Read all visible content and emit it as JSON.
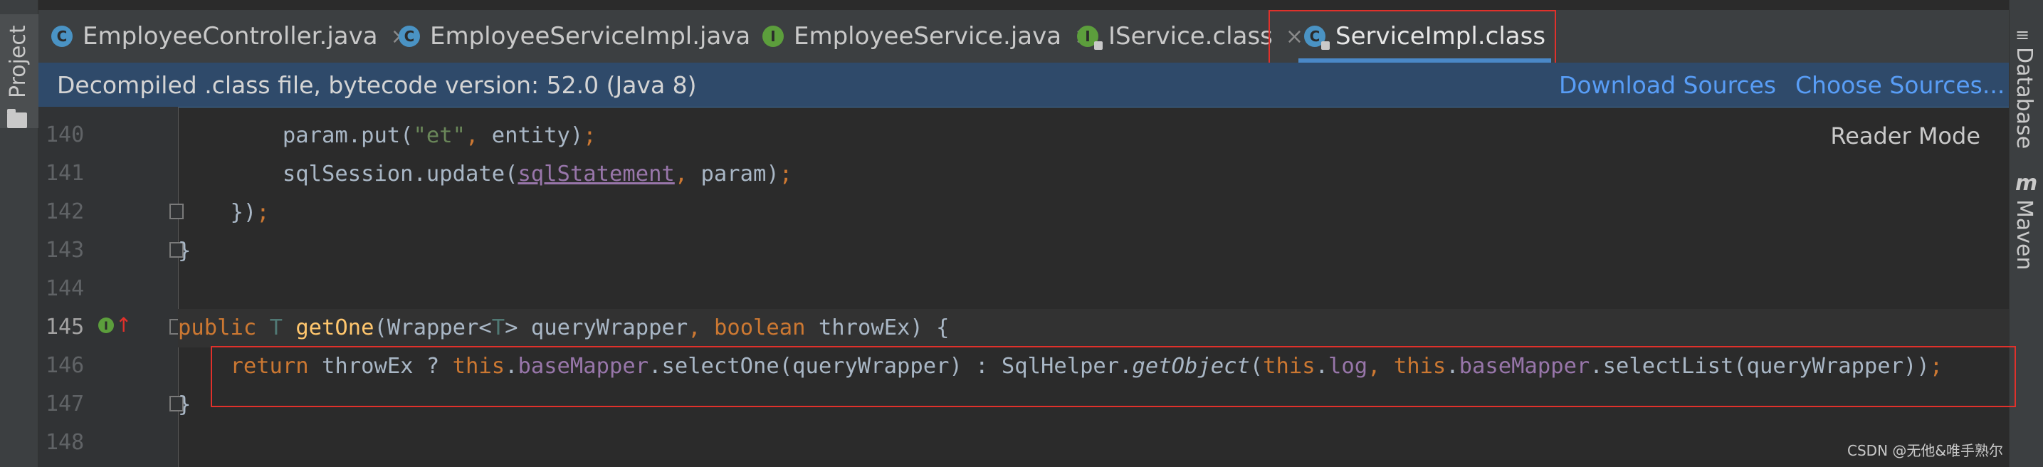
{
  "tool_windows": {
    "left": {
      "project_label": "Project",
      "folder_icon": "folder-icon"
    },
    "right": {
      "database_label": "Database",
      "maven_label": "Maven",
      "maven_icon_glyph": "m"
    }
  },
  "tabs": [
    {
      "label": "EmployeeController.java",
      "icon": "C",
      "icon_color": "#4a93c4",
      "close": "×"
    },
    {
      "label": "EmployeeServiceImpl.java",
      "icon": "C",
      "icon_color": "#4a93c4",
      "close": "×"
    },
    {
      "label": "EmployeeService.java",
      "icon": "I",
      "icon_color": "#5c9e3c",
      "close": "×"
    },
    {
      "label": "IService.class",
      "icon": "I",
      "icon_color": "#5c9e3c",
      "close": "×"
    },
    {
      "label": "ServiceImpl.class",
      "icon": "C",
      "icon_color": "#4a93c4",
      "active": true
    }
  ],
  "banner": {
    "text": "Decompiled .class file, bytecode version: 52.0 (Java 8)",
    "download_sources": "Download Sources",
    "choose_sources": "Choose Sources..."
  },
  "editor": {
    "reader_mode": "Reader Mode",
    "line_numbers": [
      "140",
      "141",
      "142",
      "143",
      "144",
      "145",
      "146",
      "147",
      "148"
    ],
    "current_line": "145"
  },
  "watermark": "CSDN @无他&唯手熟尔",
  "colors": {
    "highlight_box": "#e0312b",
    "accent": "#4a88c7",
    "link": "#589df6"
  }
}
